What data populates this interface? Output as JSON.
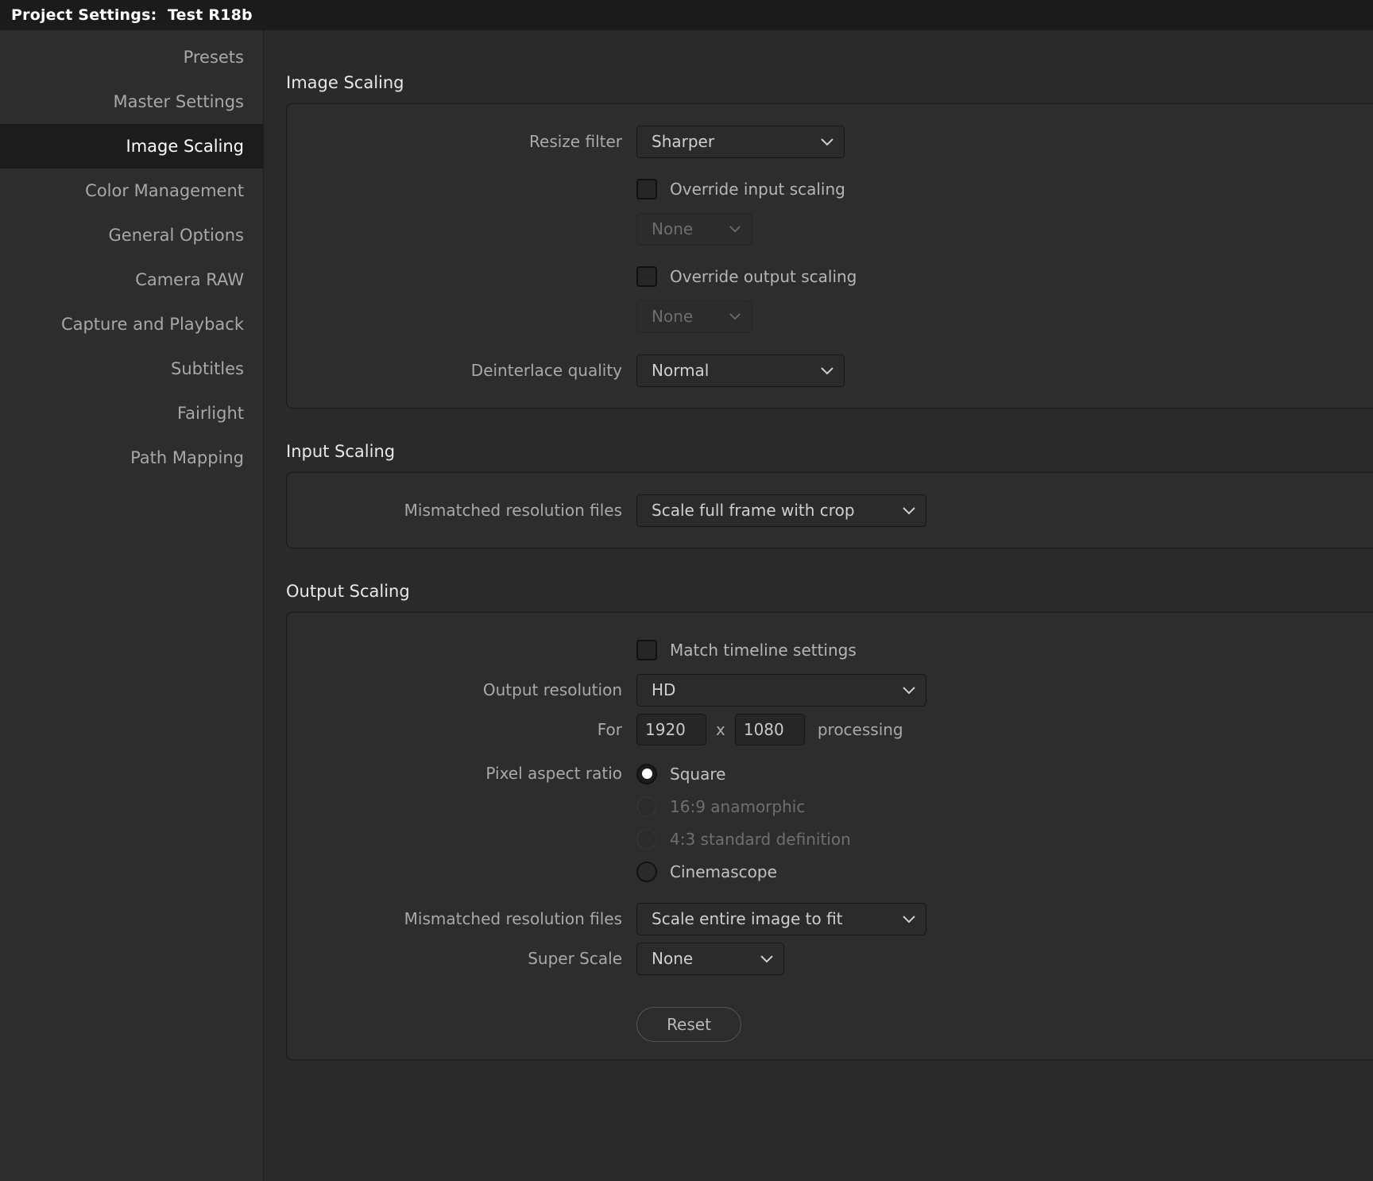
{
  "window": {
    "title": "Project Settings:  Test R18b"
  },
  "sidebar": {
    "items": [
      {
        "label": "Presets",
        "active": false
      },
      {
        "label": "Master Settings",
        "active": false
      },
      {
        "label": "Image Scaling",
        "active": true
      },
      {
        "label": "Color Management",
        "active": false
      },
      {
        "label": "General Options",
        "active": false
      },
      {
        "label": "Camera RAW",
        "active": false
      },
      {
        "label": "Capture and Playback",
        "active": false
      },
      {
        "label": "Subtitles",
        "active": false
      },
      {
        "label": "Fairlight",
        "active": false
      },
      {
        "label": "Path Mapping",
        "active": false
      }
    ]
  },
  "image_scaling": {
    "section_title": "Image Scaling",
    "resize_filter_label": "Resize filter",
    "resize_filter_value": "Sharper",
    "override_input_label": "Override input scaling",
    "override_input_checked": false,
    "override_input_value": "None",
    "override_output_label": "Override output scaling",
    "override_output_checked": false,
    "override_output_value": "None",
    "deinterlace_label": "Deinterlace quality",
    "deinterlace_value": "Normal"
  },
  "input_scaling": {
    "section_title": "Input Scaling",
    "mismatched_label": "Mismatched resolution files",
    "mismatched_value": "Scale full frame with crop"
  },
  "output_scaling": {
    "section_title": "Output Scaling",
    "match_timeline_label": "Match timeline settings",
    "match_timeline_checked": false,
    "output_resolution_label": "Output resolution",
    "output_resolution_value": "HD",
    "for_label": "For",
    "width_value": "1920",
    "height_value": "1080",
    "x_separator": "x",
    "processing_label": "processing",
    "pixel_aspect_label": "Pixel aspect ratio",
    "pixel_aspect_options": [
      {
        "label": "Square",
        "selected": true,
        "disabled": false
      },
      {
        "label": "16:9 anamorphic",
        "selected": false,
        "disabled": true
      },
      {
        "label": "4:3 standard definition",
        "selected": false,
        "disabled": true
      },
      {
        "label": "Cinemascope",
        "selected": false,
        "disabled": false
      }
    ],
    "mismatched_label": "Mismatched resolution files",
    "mismatched_value": "Scale entire image to fit",
    "super_scale_label": "Super Scale",
    "super_scale_value": "None",
    "reset_label": "Reset"
  },
  "colors": {
    "window_bg": "#2a2a2a",
    "titlebar_bg": "#1b1b1b",
    "sidebar_bg": "#2d2d2d",
    "active_item_bg": "#1c1c1c",
    "panel_bg": "#2d2d2d",
    "panel_border": "#1a1a1a",
    "control_bg": "#2b2b2b",
    "text_primary": "#e8e8e8",
    "text_secondary": "#a9a9a9",
    "text_disabled": "#6d6d6d"
  }
}
